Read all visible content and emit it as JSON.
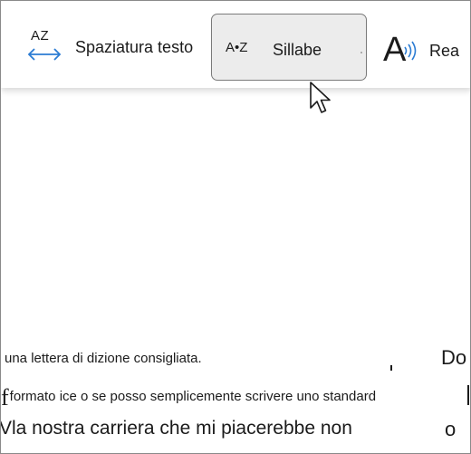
{
  "toolbar": {
    "text_spacing": {
      "icon": "text-spacing-icon",
      "icon_text": "AZ",
      "label": "Spaziatura testo"
    },
    "syllables": {
      "icon": "syllables-icon",
      "icon_text": "A•Z",
      "label": "Sillabe"
    },
    "read_aloud": {
      "icon": "read-aloud-icon",
      "icon_text": "A",
      "label": "Rea"
    }
  },
  "document": {
    "line1": "una lettera di dizione consigliata.",
    "line2_lead": "f",
    "line2": "formato ice o se posso semplicemente scrivere uno standard",
    "line3": "Vla nostra carriera che mi piacerebbe non",
    "side_top": "Do",
    "side_bottom": "o"
  },
  "colors": {
    "accent_arrow": "#2b7cd3",
    "selected_bg": "#ececec",
    "selected_border": "#7a7a7a"
  }
}
